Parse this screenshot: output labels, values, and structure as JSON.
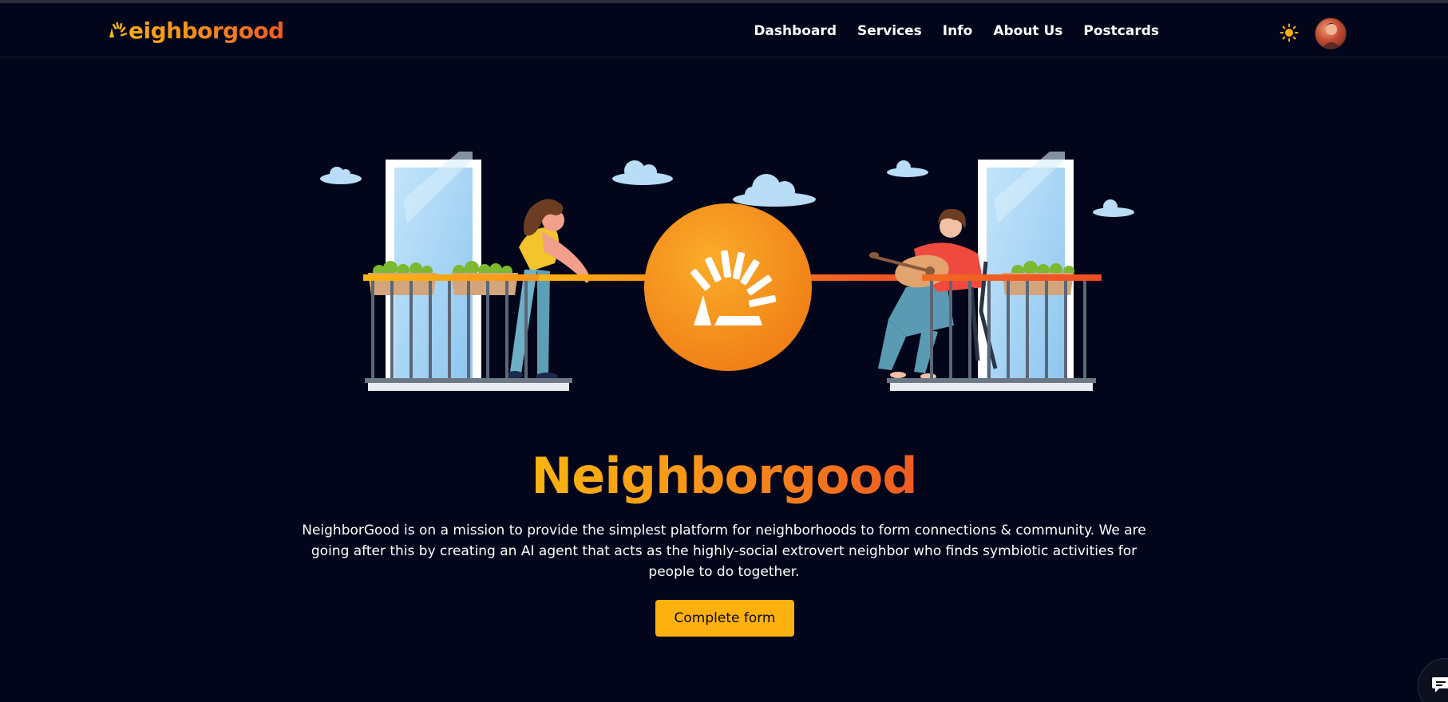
{
  "brand": {
    "name": "Neighborgood",
    "logo_text": "eighborgood"
  },
  "nav": {
    "links": [
      {
        "label": "Dashboard"
      },
      {
        "label": "Services"
      },
      {
        "label": "Info"
      },
      {
        "label": "About Us"
      },
      {
        "label": "Postcards"
      }
    ],
    "theme_icon": "sun-icon",
    "avatar_icon": "user-avatar"
  },
  "hero": {
    "title": "Neighborgood",
    "description": "NeighborGood is on a mission to provide the simplest platform for neighborhoods to form connections & community. We are going after this by creating an AI agent that acts as the highly-social extrovert neighbor who finds symbiotic activities for people to do together.",
    "cta_label": "Complete form",
    "illustration_icon": "neighbors-balcony-illustration"
  },
  "chat": {
    "icon": "chat-bubble-icon"
  },
  "colors": {
    "background": "#03061a",
    "accent_yellow": "#fdb10f",
    "accent_orange": "#f48a1c",
    "accent_red": "#ef5a23"
  }
}
